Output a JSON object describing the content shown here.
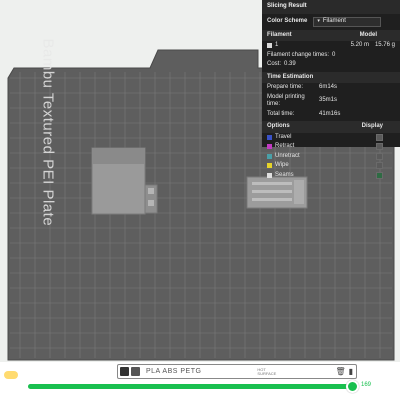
{
  "plate": {
    "label": "Bambu Textured PEI Plate"
  },
  "slicing_result": {
    "title": "Slicing Result",
    "color_scheme_label": "Color Scheme",
    "color_scheme_value": "Filament",
    "filament_header": "Filament",
    "model_header": "Model",
    "filament_rows": [
      {
        "id": "1",
        "length": "5.20 m",
        "weight": "15.76 g",
        "color": "#d9d9d9"
      }
    ],
    "filament_change_label": "Filament change times:",
    "filament_change_value": "0",
    "cost_label": "Cost:",
    "cost_value": "0.39",
    "time_estimation_title": "Time Estimation",
    "prepare_time_label": "Prepare time:",
    "prepare_time_value": "6m14s",
    "model_printing_time_label": "Model printing time:",
    "model_printing_time_value": "35m1s",
    "total_time_label": "Total time:",
    "total_time_value": "41m16s",
    "options_header": "Options",
    "display_header": "Display",
    "options": [
      {
        "label": "Travel",
        "color": "#3a52c8"
      },
      {
        "label": "Retract",
        "color": "#c23bc2"
      },
      {
        "label": "Unretract",
        "color": "#4aa0a8"
      },
      {
        "label": "Wipe",
        "color": "#e6d42a"
      },
      {
        "label": "Seams",
        "color": "#e0e0e0"
      }
    ]
  },
  "bottom": {
    "plate_types": "PLA ABS PETG",
    "small_label": "HOT SURFACE",
    "layer_slider": {
      "value": "169",
      "fraction": 0.99
    }
  },
  "colors": {
    "accent": "#19c04f",
    "plate": "#5e5e5e",
    "grid": "#7a7a7a"
  }
}
